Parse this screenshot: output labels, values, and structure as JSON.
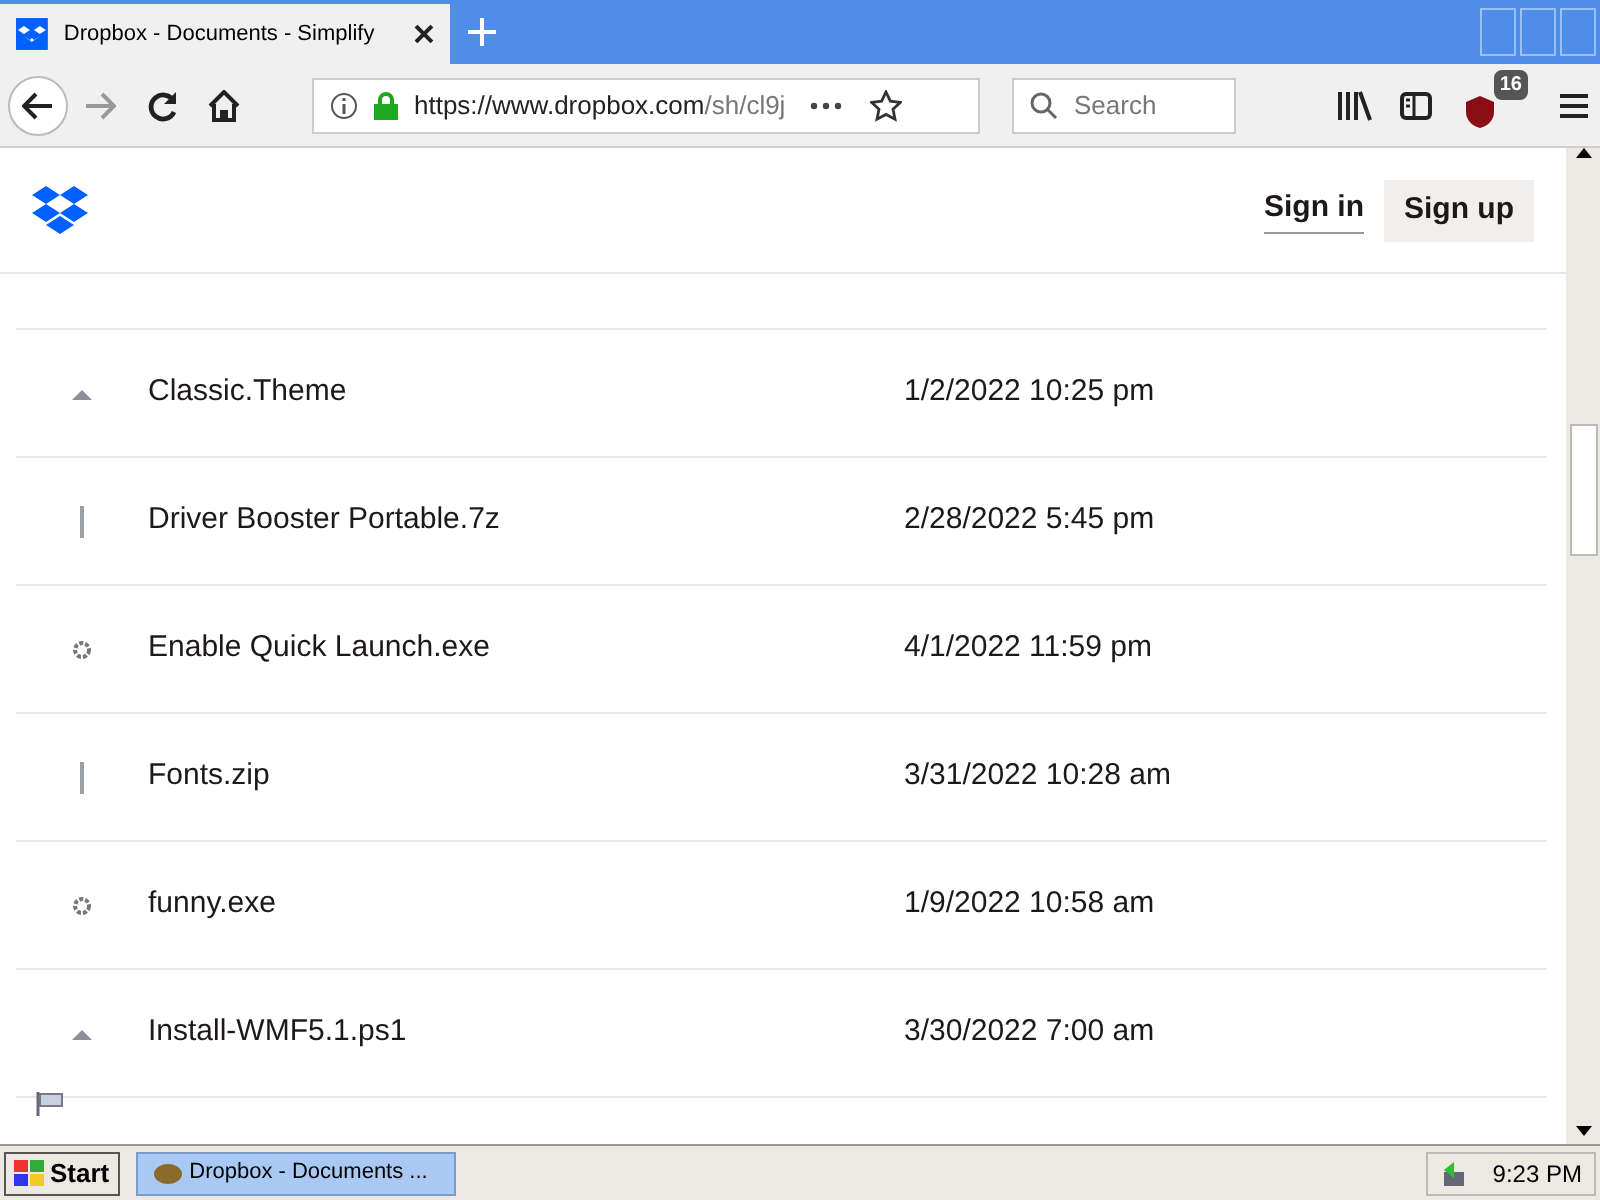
{
  "browser": {
    "tab_title": "Dropbox - Documents - Simplify",
    "url_host": "https://www.dropbox.com",
    "url_path": "/sh/cl9j",
    "search_placeholder": "Search",
    "addon_badge": "16"
  },
  "header": {
    "sign_in": "Sign in",
    "sign_up": "Sign up"
  },
  "files": [
    {
      "name": "Classic.Theme",
      "modified": "1/2/2022 10:25 pm",
      "kind": "theme"
    },
    {
      "name": "Driver Booster Portable.7z",
      "modified": "2/28/2022 5:45 pm",
      "kind": "archive"
    },
    {
      "name": "Enable Quick Launch.exe",
      "modified": "4/1/2022 11:59 pm",
      "kind": "program"
    },
    {
      "name": "Fonts.zip",
      "modified": "3/31/2022 10:28 am",
      "kind": "archive"
    },
    {
      "name": "funny.exe",
      "modified": "1/9/2022 10:58 am",
      "kind": "program"
    },
    {
      "name": "Install-WMF5.1.ps1",
      "modified": "3/30/2022 7:00 am",
      "kind": "theme"
    }
  ],
  "taskbar": {
    "start": "Start",
    "task": "Dropbox - Documents ...",
    "clock": "9:23 PM"
  }
}
